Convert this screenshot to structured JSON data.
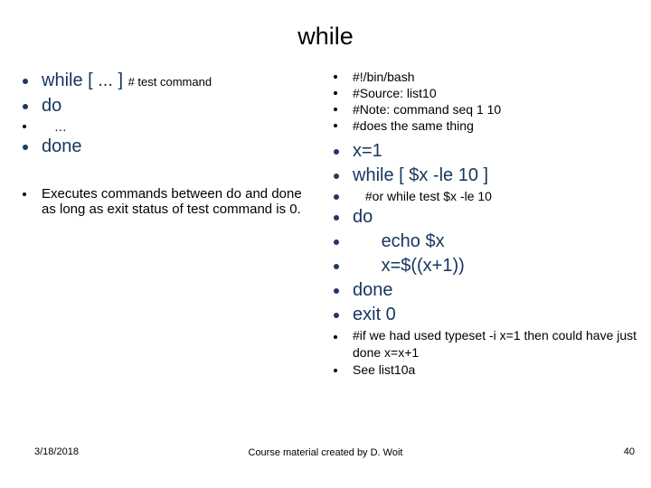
{
  "slide": {
    "title": "while",
    "left_column": [
      {
        "text": "while [ ... ]",
        "trailing_comment": "# test command",
        "style": "big"
      },
      {
        "text": "do",
        "style": "big"
      },
      {
        "text": "…",
        "style": "small"
      },
      {
        "text": "done",
        "style": "big"
      },
      {
        "text": "Executes commands between do and done as long as exit status of test command is 0.",
        "style": "para"
      }
    ],
    "right_column": [
      {
        "text": "#!/bin/bash",
        "style": "small"
      },
      {
        "text": "#Source: list10",
        "style": "small"
      },
      {
        "text": "#Note: command seq 1 10",
        "style": "small"
      },
      {
        "text": "#does the same thing",
        "style": "small"
      },
      {
        "text": "x=1",
        "style": "big"
      },
      {
        "text": "while  [ $x  -le  10 ]",
        "style": "big"
      },
      {
        "text": "#or while test $x -le 10",
        "style": "small-bluebullet"
      },
      {
        "text": "do",
        "style": "big"
      },
      {
        "text": "echo  $x",
        "style": "big",
        "indent": 1
      },
      {
        "text": "x=$((x+1))",
        "style": "big",
        "indent": 1
      },
      {
        "text": "done",
        "style": "big"
      },
      {
        "text": "exit 0",
        "style": "big"
      },
      {
        "text": "#if we had used typeset -i x=1 then could have just done x=x+1",
        "style": "small"
      },
      {
        "text": "See list10a",
        "style": "small"
      }
    ]
  },
  "footer": {
    "date": "3/18/2018",
    "credit": "Course material created by D. Woit",
    "page_number": "40"
  },
  "colors": {
    "accent_blue": "#1F3864",
    "text_blue": "#17365D",
    "text_black": "#000000",
    "background": "#FFFFFF"
  }
}
